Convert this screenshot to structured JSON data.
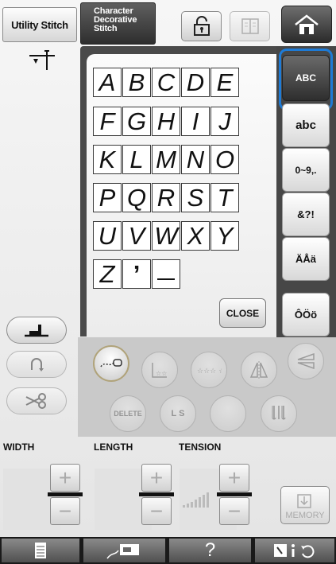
{
  "tabs": {
    "utility": "Utility Stitch",
    "character_line1": "Character",
    "character_line2": "Decorative",
    "character_line3": "Stitch"
  },
  "keyboard": {
    "rows": [
      [
        "A",
        "B",
        "C",
        "D",
        "E"
      ],
      [
        "F",
        "G",
        "H",
        "I",
        "J"
      ],
      [
        "K",
        "L",
        "M",
        "N",
        "O"
      ],
      [
        "P",
        "Q",
        "R",
        "S",
        "T"
      ],
      [
        "U",
        "V",
        "W",
        "X",
        "Y"
      ],
      [
        "Z",
        "’",
        ""
      ]
    ],
    "close": "CLOSE"
  },
  "side_tabs": [
    {
      "label": "ABC",
      "selected": true
    },
    {
      "label": "abc",
      "selected": false
    },
    {
      "label": "0~9,.",
      "selected": false
    },
    {
      "label": "&?!",
      "selected": false
    },
    {
      "label": "ÄÅä",
      "selected": false
    },
    {
      "label": "ÔÖö",
      "selected": false
    }
  ],
  "edit": {
    "delete": "DELETE",
    "ls": "L S"
  },
  "adjust": {
    "width": "WIDTH",
    "length": "LENGTH",
    "tension": "TENSION",
    "plus": "+",
    "minus": "−"
  },
  "memory": "MEMORY",
  "bottom": {
    "help": "?"
  },
  "colors": {
    "accent": "#1e7bd6",
    "panel": "#4a4a4a"
  }
}
